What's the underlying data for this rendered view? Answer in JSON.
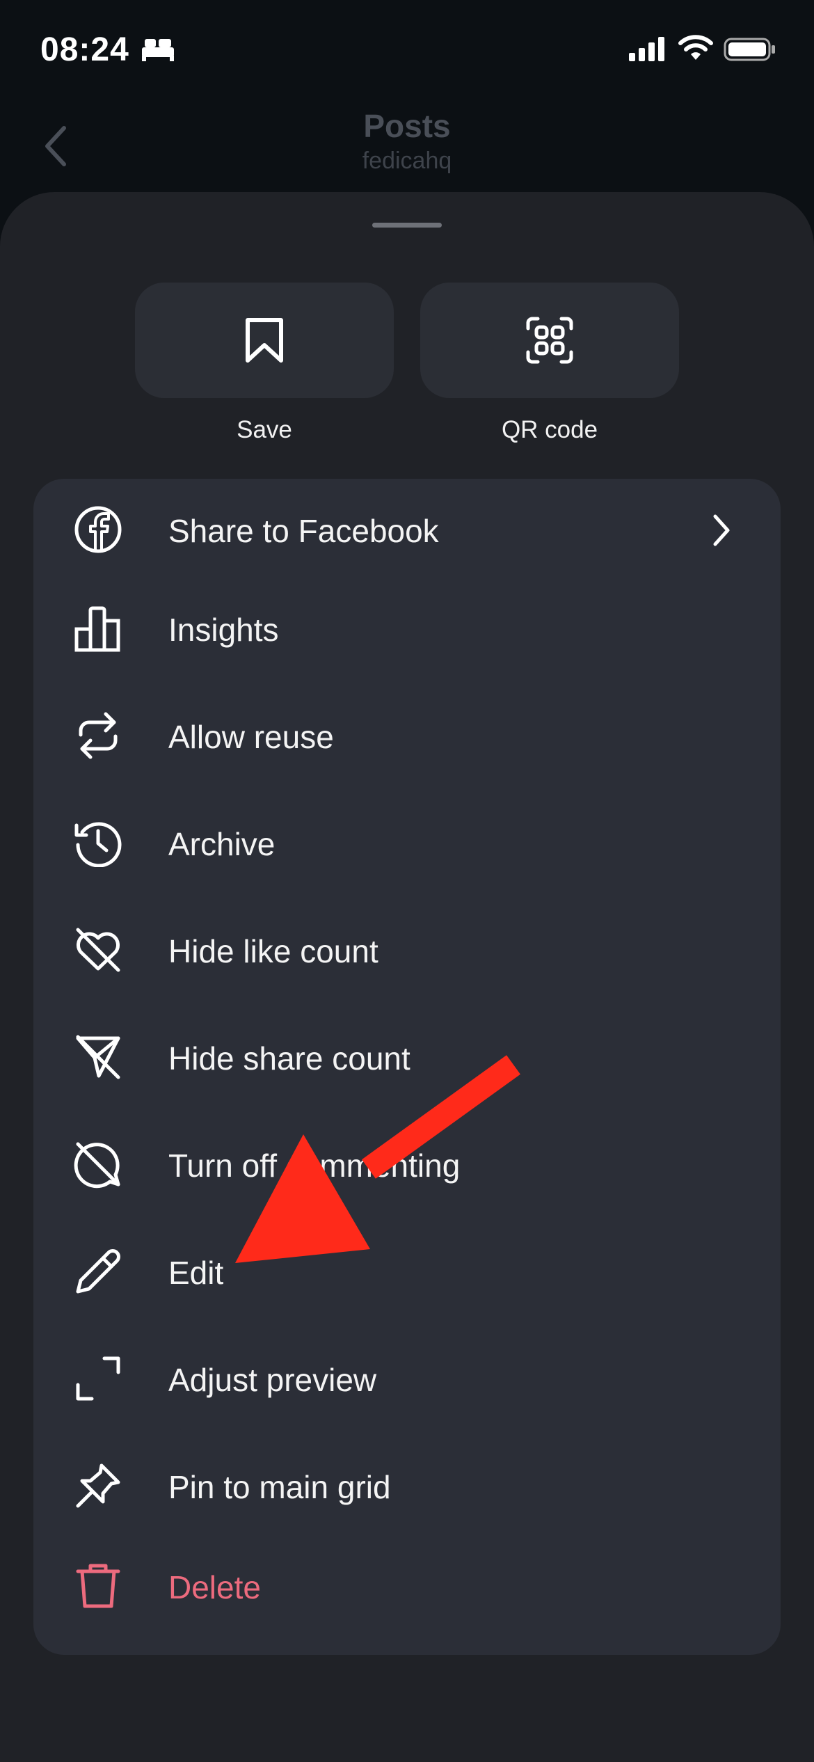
{
  "status_bar": {
    "time": "08:24"
  },
  "header": {
    "title": "Posts",
    "subtitle": "fedicahq"
  },
  "quick_actions": [
    {
      "label": "Save",
      "icon": "bookmark-icon"
    },
    {
      "label": "QR code",
      "icon": "qr-code-icon"
    }
  ],
  "menu": {
    "items": [
      {
        "label": "Share to Facebook",
        "icon": "facebook-icon"
      },
      {
        "label": "Insights",
        "icon": "bar-chart-icon"
      },
      {
        "label": "Allow reuse",
        "icon": "reuse-icon"
      },
      {
        "label": "Archive",
        "icon": "archive-history-icon"
      },
      {
        "label": "Hide like count",
        "icon": "heart-off-icon"
      },
      {
        "label": "Hide share count",
        "icon": "share-off-icon"
      },
      {
        "label": "Turn off commenting",
        "icon": "comment-off-icon"
      },
      {
        "label": "Edit",
        "icon": "pencil-icon"
      },
      {
        "label": "Adjust preview",
        "icon": "crop-icon"
      },
      {
        "label": "Pin to main grid",
        "icon": "pin-icon"
      },
      {
        "label": "Delete",
        "icon": "trash-icon"
      }
    ]
  },
  "colors": {
    "background": "#0c1014",
    "sheet": "#202227",
    "card": "#2b2e37",
    "danger": "#ed6b7e",
    "annotation_arrow": "#ff2a1a"
  }
}
